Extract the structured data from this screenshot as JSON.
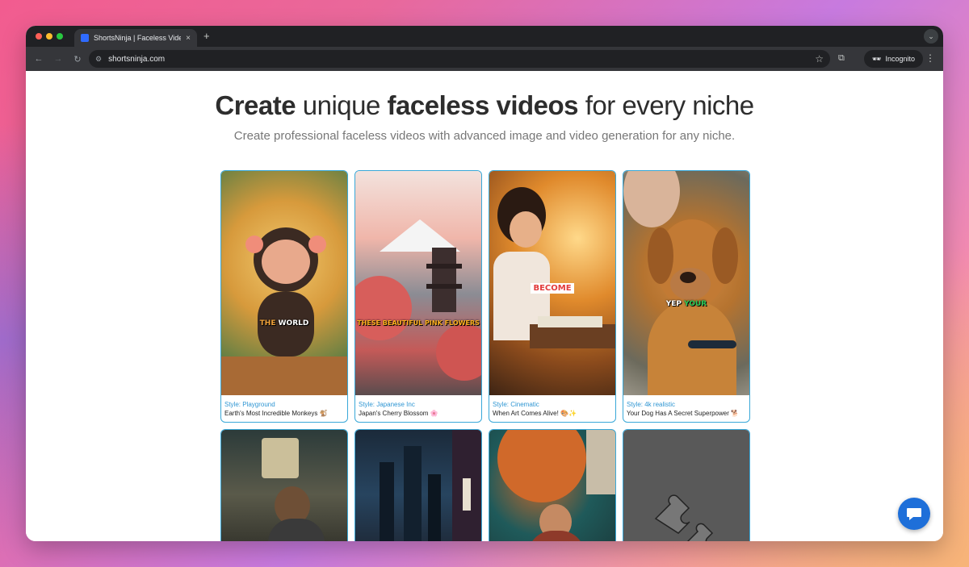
{
  "browser": {
    "tab_title": "ShortsNinja | Faceless Video",
    "tab_close": "×",
    "new_tab": "+",
    "url": "shortsninja.com",
    "incognito_label": "Incognito",
    "traffic_lights": [
      "#ff5f57",
      "#febc2e",
      "#28c840"
    ]
  },
  "hero": {
    "headline_part1": "Create",
    "headline_part2": " unique ",
    "headline_part3": "faceless videos",
    "headline_part4": " for every niche",
    "subtitle": "Create professional faceless videos with advanced image and video generation for any niche."
  },
  "cards": [
    {
      "style": "Style: Playground",
      "title": "Earth's Most Incredible Monkeys 🐒",
      "caption_a": "THE",
      "caption_b": " WORLD"
    },
    {
      "style": "Style: Japanese Inc",
      "title": "Japan's Cherry Blossom 🌸",
      "caption_a": "THESE BEAUTIFUL PINK FLOWERS",
      "caption_b": ""
    },
    {
      "style": "Style: Cinematic",
      "title": "When Art Comes Alive! 🎨✨",
      "caption_a": "BECOME",
      "caption_b": ""
    },
    {
      "style": "Style: 4k realistic",
      "title": "Your Dog Has A Secret Superpower 🐕",
      "caption_a": "YEP",
      "caption_b": " YOUR"
    }
  ],
  "colors": {
    "accent": "#39a8d8",
    "style_text": "#2f96d3",
    "chat_button": "#1e6fd9"
  }
}
